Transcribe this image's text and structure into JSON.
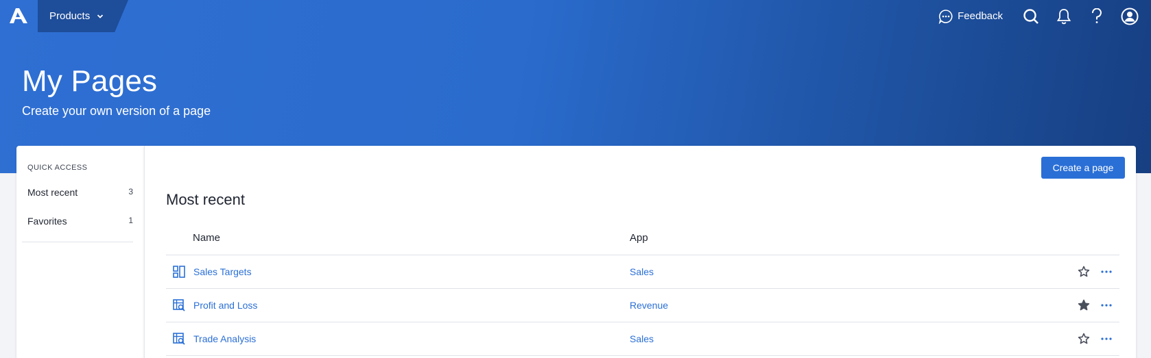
{
  "topbar": {
    "products_label": "Products",
    "feedback_label": "Feedback"
  },
  "header": {
    "title": "My Pages",
    "subtitle": "Create your own version of a page"
  },
  "sidebar": {
    "section_title": "QUICK ACCESS",
    "items": [
      {
        "label": "Most recent",
        "count": "3"
      },
      {
        "label": "Favorites",
        "count": "1"
      }
    ]
  },
  "main": {
    "create_button": "Create a page",
    "section_title": "Most recent",
    "columns": {
      "name": "Name",
      "app": "App"
    },
    "rows": [
      {
        "name": "Sales Targets",
        "app": "Sales",
        "icon": "dashboard-icon",
        "favorite": false
      },
      {
        "name": "Profit and Loss",
        "app": "Revenue",
        "icon": "report-icon",
        "favorite": true
      },
      {
        "name": "Trade Analysis",
        "app": "Sales",
        "icon": "report-icon",
        "favorite": false
      }
    ]
  },
  "colors": {
    "accent": "#2a6fd6",
    "header_gradient_start": "#2f6fd3",
    "header_gradient_end": "#173f82",
    "products_tab": "#1e4d99",
    "star": "#4a4f5c"
  }
}
